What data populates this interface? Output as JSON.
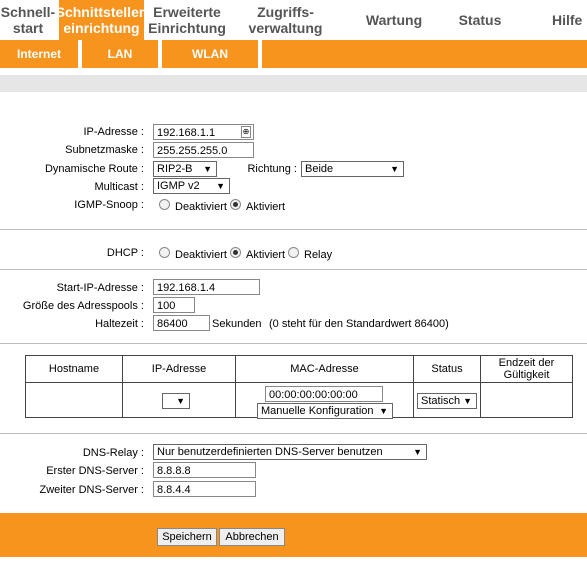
{
  "nav": {
    "items": [
      {
        "line1": "Schnell-",
        "line2": "start"
      },
      {
        "line1": "Schnittstellen",
        "line2": "einrichtung"
      },
      {
        "line1": "Erweiterte",
        "line2": "Einrichtung"
      },
      {
        "line1": "Zugriffs-",
        "line2": "verwaltung"
      },
      {
        "line1": "Wartung",
        "line2": ""
      },
      {
        "line1": "Status",
        "line2": ""
      },
      {
        "line1": "Hilfe",
        "line2": ""
      }
    ],
    "active_index": 1,
    "active_color": "#f7941d"
  },
  "subnav": {
    "items": [
      "Internet",
      "LAN",
      "WLAN"
    ]
  },
  "lan": {
    "ip_label": "IP-Adresse",
    "ip_value": "192.168.1.1",
    "mask_label": "Subnetzmaske",
    "mask_value": "255.255.255.0",
    "route_label": "Dynamische Route",
    "route_value": "RIP2-B",
    "direction_label": "Richtung",
    "direction_value": "Beide",
    "multicast_label": "Multicast",
    "multicast_value": "IGMP v2",
    "igmp_label": "IGMP-Snoop",
    "igmp_off": "Deaktiviert",
    "igmp_on": "Aktiviert",
    "igmp_selected": "Aktiviert"
  },
  "dhcp": {
    "label": "DHCP",
    "opt_off": "Deaktiviert",
    "opt_on": "Aktiviert",
    "opt_relay": "Relay",
    "selected": "Aktiviert",
    "start_label": "Start-IP-Adresse",
    "start_value": "192.168.1.4",
    "pool_label": "Größe des Adresspools",
    "pool_value": "100",
    "lease_label": "Haltezeit",
    "lease_value": "86400",
    "lease_unit": "Sekunden",
    "lease_note": "(0 steht für den Standardwert 86400)"
  },
  "table": {
    "headers": [
      "Hostname",
      "IP-Adresse",
      "MAC-Adresse",
      "Status",
      "Endzeit der Gültigkeit"
    ],
    "mac_value": "00:00:00:00:00:00",
    "mac_mode": "Manuelle Konfiguration",
    "status_value": "Statisch"
  },
  "dns": {
    "relay_label": "DNS-Relay",
    "relay_value": "Nur benutzerdefinierten DNS-Server benutzen",
    "first_label": "Erster DNS-Server",
    "first_value": "8.8.8.8",
    "second_label": "Zweiter DNS-Server",
    "second_value": "8.8.4.4"
  },
  "buttons": {
    "save": "Speichern",
    "cancel": "Abbrechen"
  }
}
